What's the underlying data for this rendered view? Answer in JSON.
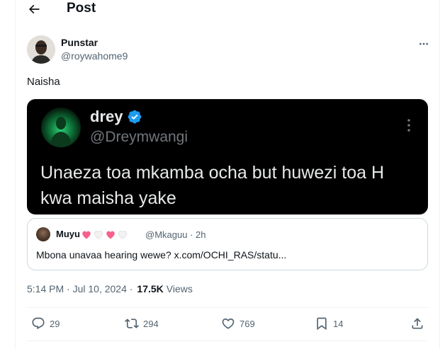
{
  "header": {
    "title": "Post"
  },
  "author": {
    "display_name": "Punstar",
    "handle": "@roywahome9"
  },
  "tweet": {
    "text": "Naisha"
  },
  "media_post": {
    "display_name": "drey",
    "handle": "@Dreymwangi",
    "verified": true,
    "text": "Unaeza toa mkamba ocha but huwezi toa H kwa maisha yake"
  },
  "quote": {
    "display_name": "Muyu",
    "hearts": [
      "pink",
      "white",
      "pink",
      "white"
    ],
    "handle": "@Mkaguu",
    "separator": "·",
    "time": "2h",
    "text": "Mbona unavaa hearing wewe? x.com/OCHI_RAS/statu..."
  },
  "meta": {
    "timestamp": "5:14 PM · Jul 10, 2024 ·",
    "views_count": "17.5K",
    "views_label": "Views"
  },
  "actions": {
    "replies": "29",
    "reposts": "294",
    "likes": "769",
    "bookmarks": "14"
  },
  "colors": {
    "verified_badge": "#1d9bf0",
    "heart_pink": "#f7618b",
    "secondary_text": "#536471"
  }
}
